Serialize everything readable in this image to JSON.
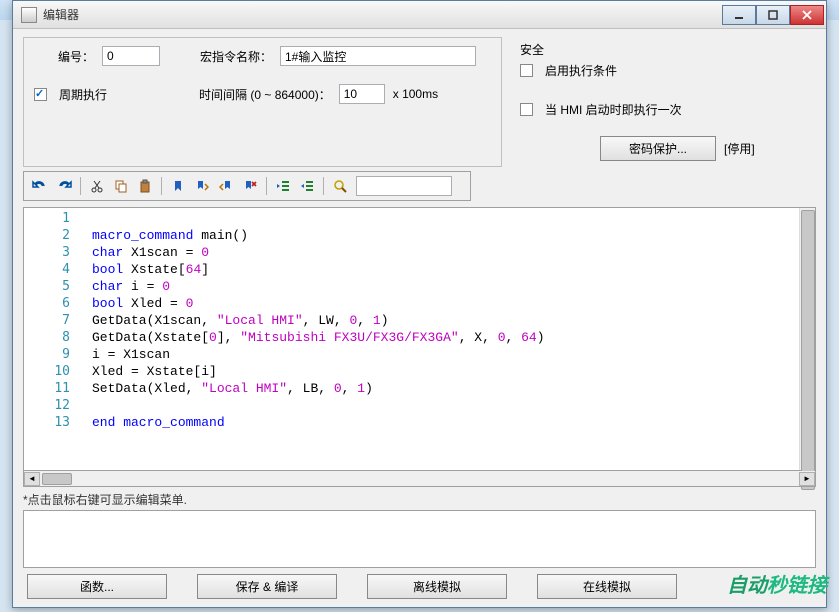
{
  "window": {
    "title": "编辑器"
  },
  "form": {
    "id_label": "编号：",
    "id_value": "0",
    "macro_name_label": "宏指令名称：",
    "macro_name_value": "1#输入监控",
    "periodic_label": "周期执行",
    "interval_label": "时间间隔 (0 ~ 864000)：",
    "interval_value": "10",
    "interval_unit": "x 100ms"
  },
  "security": {
    "group_title": "安全",
    "enable_cond_label": "启用执行条件",
    "hmi_once_label": "当 HMI 启动时即执行一次",
    "password_btn": "密码保护...",
    "disable_label": "[停用]"
  },
  "toolbar": {
    "search_value": ""
  },
  "code_lines": [
    {
      "n": 1,
      "t": [
        [
          "",
          ""
        ]
      ]
    },
    {
      "n": 2,
      "t": [
        [
          "kw",
          "macro_command"
        ],
        [
          "",
          " main()"
        ]
      ]
    },
    {
      "n": 3,
      "t": [
        [
          "kw",
          "char"
        ],
        [
          "",
          " X1scan = "
        ],
        [
          "num",
          "0"
        ]
      ]
    },
    {
      "n": 4,
      "t": [
        [
          "kw",
          "bool"
        ],
        [
          "",
          " Xstate["
        ],
        [
          "num",
          "64"
        ],
        [
          "",
          "]"
        ]
      ]
    },
    {
      "n": 5,
      "t": [
        [
          "kw",
          "char"
        ],
        [
          "",
          " i = "
        ],
        [
          "num",
          "0"
        ]
      ]
    },
    {
      "n": 6,
      "t": [
        [
          "kw",
          "bool"
        ],
        [
          "",
          " Xled = "
        ],
        [
          "num",
          "0"
        ]
      ]
    },
    {
      "n": 7,
      "t": [
        [
          "",
          "GetData(X1scan, "
        ],
        [
          "str",
          "\"Local HMI\""
        ],
        [
          "",
          ", LW, "
        ],
        [
          "num",
          "0"
        ],
        [
          "",
          ", "
        ],
        [
          "num",
          "1"
        ],
        [
          "",
          ")"
        ]
      ]
    },
    {
      "n": 8,
      "t": [
        [
          "",
          "GetData(Xstate["
        ],
        [
          "num",
          "0"
        ],
        [
          "",
          "], "
        ],
        [
          "str",
          "\"Mitsubishi FX3U/FX3G/FX3GA\""
        ],
        [
          "",
          ", X, "
        ],
        [
          "num",
          "0"
        ],
        [
          "",
          ", "
        ],
        [
          "num",
          "64"
        ],
        [
          "",
          ")"
        ]
      ]
    },
    {
      "n": 9,
      "t": [
        [
          "",
          "i = X1scan"
        ]
      ]
    },
    {
      "n": 10,
      "t": [
        [
          "",
          "Xled = Xstate[i]"
        ]
      ]
    },
    {
      "n": 11,
      "t": [
        [
          "",
          "SetData(Xled, "
        ],
        [
          "str",
          "\"Local HMI\""
        ],
        [
          "",
          ", LB, "
        ],
        [
          "num",
          "0"
        ],
        [
          "",
          ", "
        ],
        [
          "num",
          "1"
        ],
        [
          "",
          ")"
        ]
      ]
    },
    {
      "n": 12,
      "t": [
        [
          "",
          ""
        ]
      ]
    },
    {
      "n": 13,
      "t": [
        [
          "kw",
          "end macro_command"
        ]
      ]
    }
  ],
  "hint": "*点击鼠标右键可显示编辑菜单.",
  "bottom_buttons": {
    "functions": "函数...",
    "save_compile": "保存 & 编译",
    "offline_sim": "离线模拟",
    "online_sim": "在线模拟"
  },
  "watermark": "自动秒链接"
}
